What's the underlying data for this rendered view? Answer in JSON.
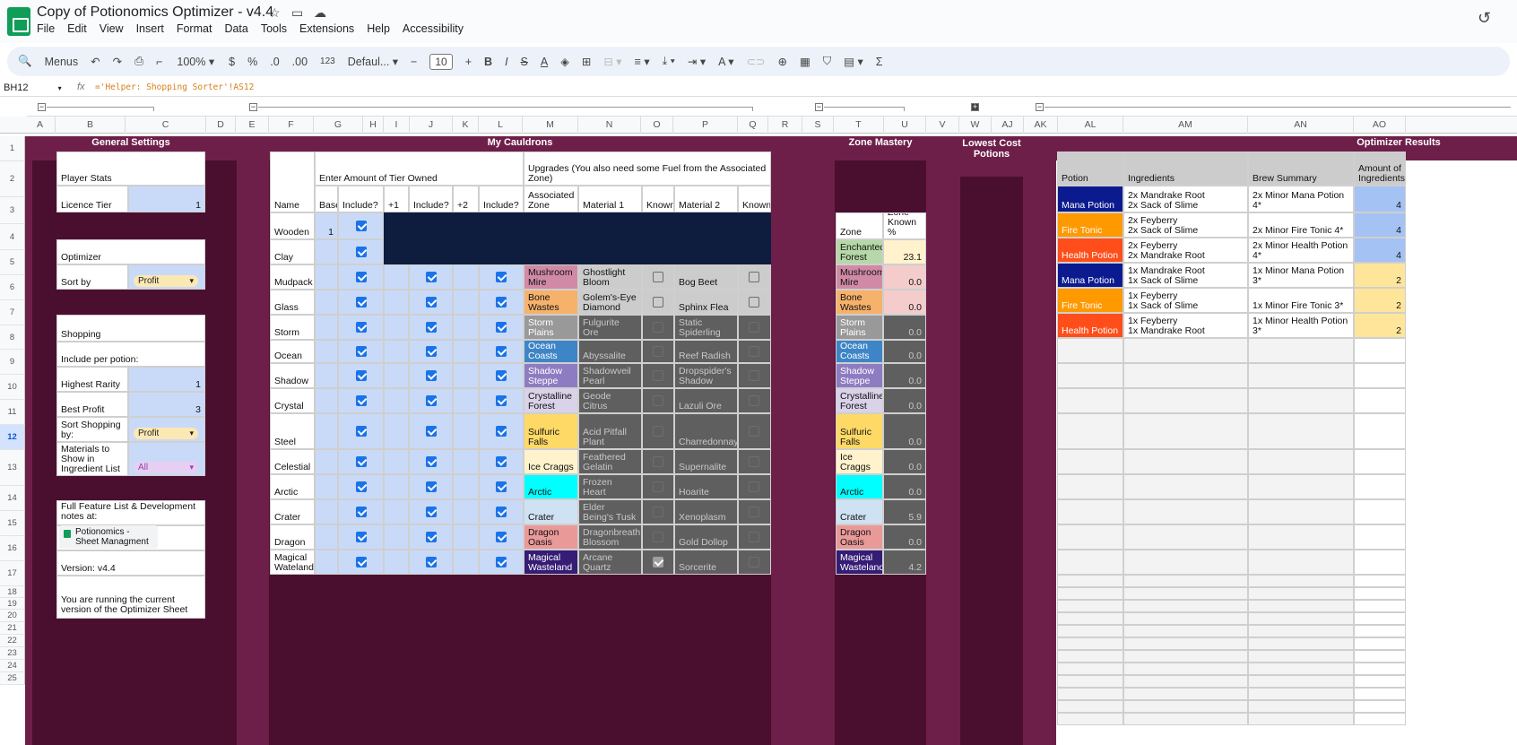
{
  "app": {
    "title": "Copy of Potionomics Optimizer - v4.4",
    "menus": [
      "File",
      "Edit",
      "View",
      "Insert",
      "Format",
      "Data",
      "Tools",
      "Extensions",
      "Help",
      "Accessibility"
    ]
  },
  "toolbar": {
    "menus_label": "Menus",
    "zoom": "100%",
    "currency": "$",
    "percent": "%",
    "dec_decrease": ".0",
    "dec_increase": ".00",
    "number_format": "123",
    "font": "Defaul...",
    "font_size": "10",
    "bold": "B",
    "italic": "I",
    "strike": "S",
    "text_color": "A",
    "sum": "Σ"
  },
  "formula_bar": {
    "cell_ref": "BH12",
    "fx": "fx",
    "formula": "='Helper: Shopping Sorter'!AS12"
  },
  "columns": [
    "A",
    "B",
    "C",
    "D",
    "E",
    "F",
    "G",
    "H",
    "I",
    "J",
    "K",
    "L",
    "M",
    "N",
    "O",
    "P",
    "Q",
    "R",
    "S",
    "T",
    "U",
    "V",
    "W",
    "AJ",
    "AK",
    "AL",
    "AM",
    "AN",
    "AO"
  ],
  "rows": [
    "1",
    "2",
    "3",
    "4",
    "5",
    "6",
    "7",
    "8",
    "9",
    "10",
    "11",
    "12",
    "13",
    "14",
    "15",
    "16",
    "17",
    "18",
    "19",
    "20",
    "21",
    "22",
    "23",
    "24",
    "25"
  ],
  "general": {
    "title": "General Settings",
    "player_stats": "Player Stats",
    "licence_tier_label": "Licence Tier",
    "licence_tier_value": "1",
    "optimizer": "Optimizer",
    "sort_by_label": "Sort by",
    "sort_by_value": "Profit",
    "shopping": "Shopping",
    "include_per_potion": "Include per potion:",
    "highest_rarity_label": "Highest Rarity",
    "highest_rarity_value": "1",
    "best_profit_label": "Best Profit",
    "best_profit_value": "3",
    "sort_shopping_label": "Sort Shopping by:",
    "sort_shopping_value": "Profit",
    "materials_label": "Materials to Show in Ingredient List",
    "materials_value": "All",
    "feature_notes": "Full Feature List & Development notes at:",
    "link_text": "Potionomics - Sheet Managment",
    "version": "Version: v4.4",
    "version_status": "You are running the current version of the Optimizer Sheet"
  },
  "cauldrons": {
    "title": "My Cauldrons",
    "tier_header": "Enter Amount of Tier Owned",
    "upgrades_header": "Upgrades (You also need some Fuel from the Associated Zone)",
    "headers": [
      "Name",
      "Base",
      "Include?",
      "+1",
      "Include?",
      "+2",
      "Include?",
      "Associated Zone",
      "Material 1",
      "Known",
      "Material 2",
      "Known"
    ],
    "rows": [
      {
        "name": "Wooden",
        "base": "1",
        "zone": "",
        "mat1": "",
        "mat2": ""
      },
      {
        "name": "Clay",
        "base": "",
        "zone": "",
        "mat1": "",
        "mat2": ""
      },
      {
        "name": "Mudpack",
        "base": "",
        "zone": "Mushroom Mire",
        "mat1": "Ghostlight Bloom",
        "mat2": "Bog Beet"
      },
      {
        "name": "Glass",
        "base": "",
        "zone": "Bone Wastes",
        "mat1": "Golem's-Eye Diamond",
        "mat2": "Sphinx Flea"
      },
      {
        "name": "Storm",
        "base": "",
        "zone": "Storm Plains",
        "mat1": "Fulgurite Ore",
        "mat2": "Static Spiderling"
      },
      {
        "name": "Ocean",
        "base": "",
        "zone": "Ocean Coasts",
        "mat1": "Abyssalite",
        "mat2": "Reef Radish"
      },
      {
        "name": "Shadow",
        "base": "",
        "zone": "Shadow Steppe",
        "mat1": "Shadowveil Pearl",
        "mat2": "Dropspider's Shadow"
      },
      {
        "name": "Crystal",
        "base": "",
        "zone": "Crystalline Forest",
        "mat1": "Geode Citrus",
        "mat2": "Lazuli Ore"
      },
      {
        "name": "Steel",
        "base": "",
        "zone": "Sulfuric Falls",
        "mat1": "Acid Pitfall Plant",
        "mat2": "Charredonnay"
      },
      {
        "name": "Celestial",
        "base": "",
        "zone": "Ice Craggs",
        "mat1": "Feathered Gelatin",
        "mat2": "Supernalite"
      },
      {
        "name": "Arctic",
        "base": "",
        "zone": "Arctic",
        "mat1": "Jotunn's Frozen Heart",
        "mat2": "Hoarite"
      },
      {
        "name": "Crater",
        "base": "",
        "zone": "Crater",
        "mat1": "Elder Being's Tusk",
        "mat2": "Xenoplasm"
      },
      {
        "name": "Dragon",
        "base": "",
        "zone": "Dragon Oasis",
        "mat1": "Dragonbreath Blossom",
        "mat2": "Gold Dollop"
      },
      {
        "name": "Magical Wateland",
        "base": "",
        "zone": "Magical Wasteland",
        "mat1": "Arcane Quartz",
        "mat2": "Sorcerite"
      }
    ]
  },
  "zones": {
    "title": "Zone Mastery",
    "headers": [
      "Zone",
      "Zone Known %"
    ],
    "rows": [
      {
        "zone": "Enchanted Forest",
        "pct": "23.1"
      },
      {
        "zone": "Mushroom Mire",
        "pct": "0.0"
      },
      {
        "zone": "Bone Wastes",
        "pct": "0.0"
      },
      {
        "zone": "Storm Plains",
        "pct": "0.0"
      },
      {
        "zone": "Ocean Coasts",
        "pct": "0.0"
      },
      {
        "zone": "Shadow Steppe",
        "pct": "0.0"
      },
      {
        "zone": "Crystalline Forest",
        "pct": "0.0"
      },
      {
        "zone": "Sulfuric Falls",
        "pct": "0.0"
      },
      {
        "zone": "Ice Craggs",
        "pct": "0.0"
      },
      {
        "zone": "Arctic",
        "pct": "0.0"
      },
      {
        "zone": "Crater",
        "pct": "5.9"
      },
      {
        "zone": "Dragon Oasis",
        "pct": "0.0"
      },
      {
        "zone": "Magical Wasteland",
        "pct": "4.2"
      }
    ]
  },
  "lowest_cost": {
    "title": "Lowest Cost Potions"
  },
  "results": {
    "title": "Optimizer Results",
    "headers": [
      "Potion",
      "Ingredients",
      "Brew Summary",
      "Amount of Ingredients"
    ],
    "rows": [
      {
        "potion": "Mana Potion",
        "ing1": "2x Mandrake Root",
        "ing2": "2x Sack of Slime",
        "summary": "2x Minor Mana Potion 4*",
        "amount": "4"
      },
      {
        "potion": "Fire Tonic",
        "ing1": "2x Feyberry",
        "ing2": "2x Sack of Slime",
        "summary": "2x Minor Fire Tonic 4*",
        "amount": "4"
      },
      {
        "potion": "Health Potion",
        "ing1": "2x Feyberry",
        "ing2": "2x Mandrake Root",
        "summary": "2x Minor Health Potion 4*",
        "amount": "4"
      },
      {
        "potion": "Mana Potion",
        "ing1": "1x Mandrake Root",
        "ing2": "1x Sack of Slime",
        "summary": "1x Minor Mana Potion 3*",
        "amount": "2"
      },
      {
        "potion": "Fire Tonic",
        "ing1": "1x Feyberry",
        "ing2": "1x Sack of Slime",
        "summary": "1x Minor Fire Tonic 3*",
        "amount": "2"
      },
      {
        "potion": "Health Potion",
        "ing1": "1x Feyberry",
        "ing2": "1x Mandrake Root",
        "summary": "1x Minor Health Potion 3*",
        "amount": "2"
      }
    ]
  },
  "colors": {
    "background": "#6e1f49",
    "panel": "#4a0f2e",
    "input_blue": "#c9daf8",
    "dark_material": "#5f5f5f",
    "navy": "#0e1d3d",
    "checkbox": "#1a73e8"
  },
  "icons": [
    "sheets-logo-icon",
    "star-icon",
    "move-folder-icon",
    "cloud-status-icon",
    "history-icon",
    "search-icon",
    "undo-icon",
    "redo-icon",
    "print-icon",
    "paint-format-icon",
    "fill-color-icon",
    "borders-icon",
    "merge-icon",
    "align-icon",
    "valign-icon",
    "wrap-icon",
    "rotate-icon",
    "link-icon",
    "comment-icon",
    "chart-icon",
    "filter-icon",
    "table-icon",
    "functions-icon"
  ]
}
